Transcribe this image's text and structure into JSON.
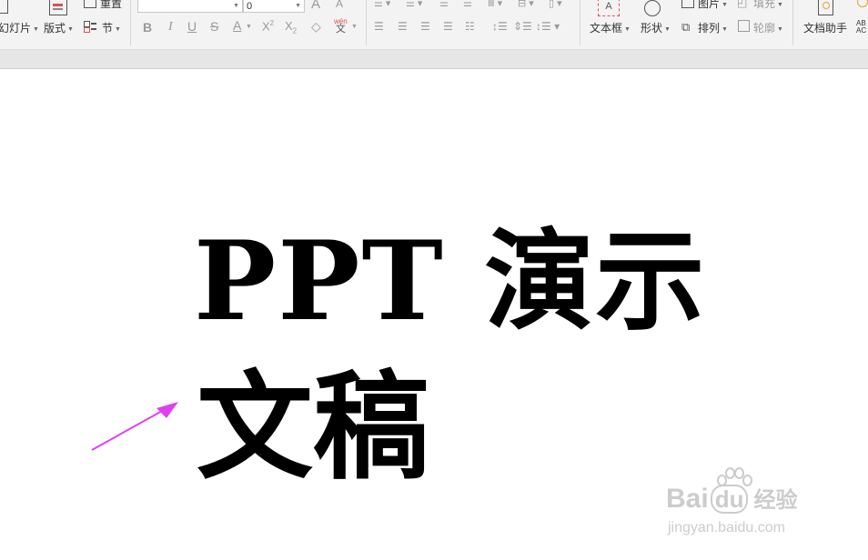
{
  "ribbon": {
    "new_slide_label": "幻灯片",
    "layout_label": "版式",
    "reset_label": "重置",
    "section_label": "节",
    "font_name_value": "",
    "font_size_value": "0",
    "textbox_label": "文本框",
    "shape_label": "形状",
    "picture_label": "图片",
    "fill_label": "填充",
    "arrange_label": "排列",
    "outline_label": "轮廓",
    "doc_assistant_label": "文档助手",
    "wen_label": "wén"
  },
  "slide": {
    "title_line1": "PPT 演示",
    "title_line2": "文稿"
  },
  "watermark": {
    "brand_prefix": "Bai",
    "brand_suffix": "du",
    "brand_cn": "经验",
    "url": "jingyan.baidu.com"
  },
  "colors": {
    "arrow": "#e040f0",
    "ribbon_bg": "#f3f3f3",
    "watermark": "#cccccc"
  }
}
